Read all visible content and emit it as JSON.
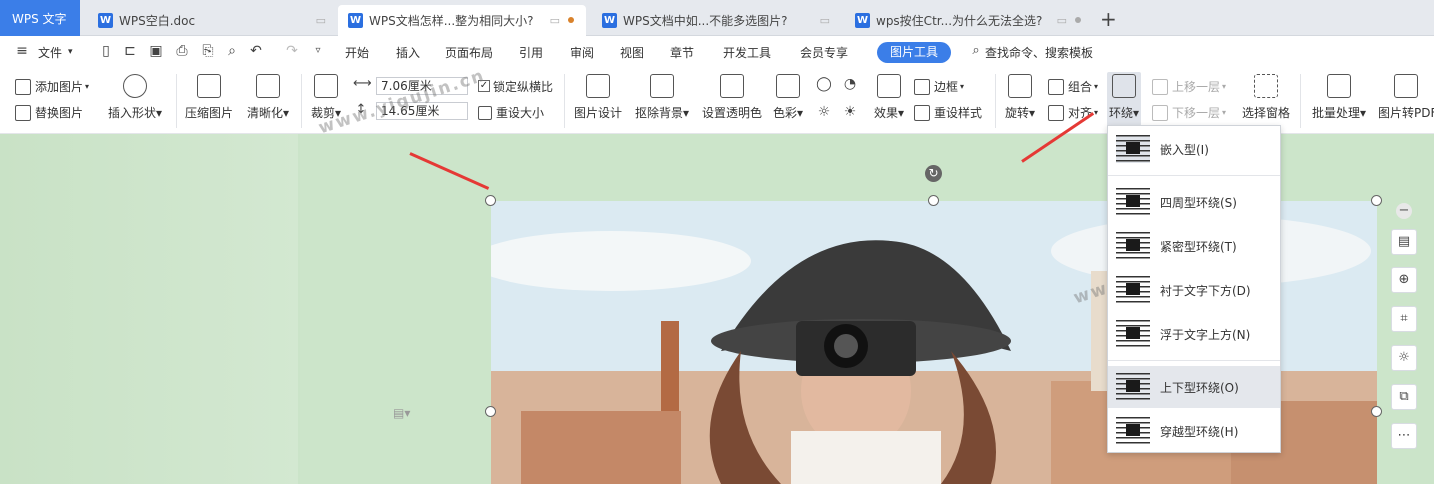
{
  "tabs": [
    {
      "label": "WPS 文字"
    },
    {
      "label": "WPS空白.doc"
    },
    {
      "label": "WPS文档怎样...整为相同大小?"
    },
    {
      "label": "WPS文档中如...不能多选图片?"
    },
    {
      "label": "wps按住Ctr...为什么无法全选?"
    }
  ],
  "new_tab": "+",
  "menu": {
    "file": "文件",
    "items": [
      "开始",
      "插入",
      "页面布局",
      "引用",
      "审阅",
      "视图",
      "章节",
      "开发工具",
      "会员专享"
    ],
    "picture_tools": "图片工具",
    "search": "查找命令、搜索模板"
  },
  "ribbon": {
    "add_image": "添加图片",
    "replace_image": "替换图片",
    "insert_shape": "插入形状",
    "compress": "压缩图片",
    "sharpen": "清晰化",
    "crop": "裁剪",
    "width": "7.06厘米",
    "height": "14.65厘米",
    "lock_ratio": "锁定纵横比",
    "reset_size": "重设大小",
    "design": "图片设计",
    "remove_bg": "抠除背景",
    "transparent": "设置透明色",
    "color": "色彩",
    "effect": "效果",
    "border": "边框",
    "reset_style": "重设样式",
    "rotate": "旋转",
    "group": "组合",
    "align": "对齐",
    "wrap": "环绕",
    "bring_forward": "上移一层",
    "send_backward": "下移一层",
    "selection_pane": "选择窗格",
    "batch": "批量处理",
    "to_pdf": "图片转PDF"
  },
  "wrap_menu": [
    {
      "label": "嵌入型(I)"
    },
    {
      "label": "四周型环绕(S)"
    },
    {
      "label": "紧密型环绕(T)"
    },
    {
      "label": "衬于文字下方(D)"
    },
    {
      "label": "浮于文字上方(N)"
    },
    {
      "label": "上下型环绕(O)"
    },
    {
      "label": "穿越型环绕(H)"
    }
  ],
  "watermark": "www.yigujin.cn",
  "colors": {
    "accent": "#3b7ee8",
    "arrow": "#e53935",
    "doc_bg": "#cbe4c9"
  }
}
